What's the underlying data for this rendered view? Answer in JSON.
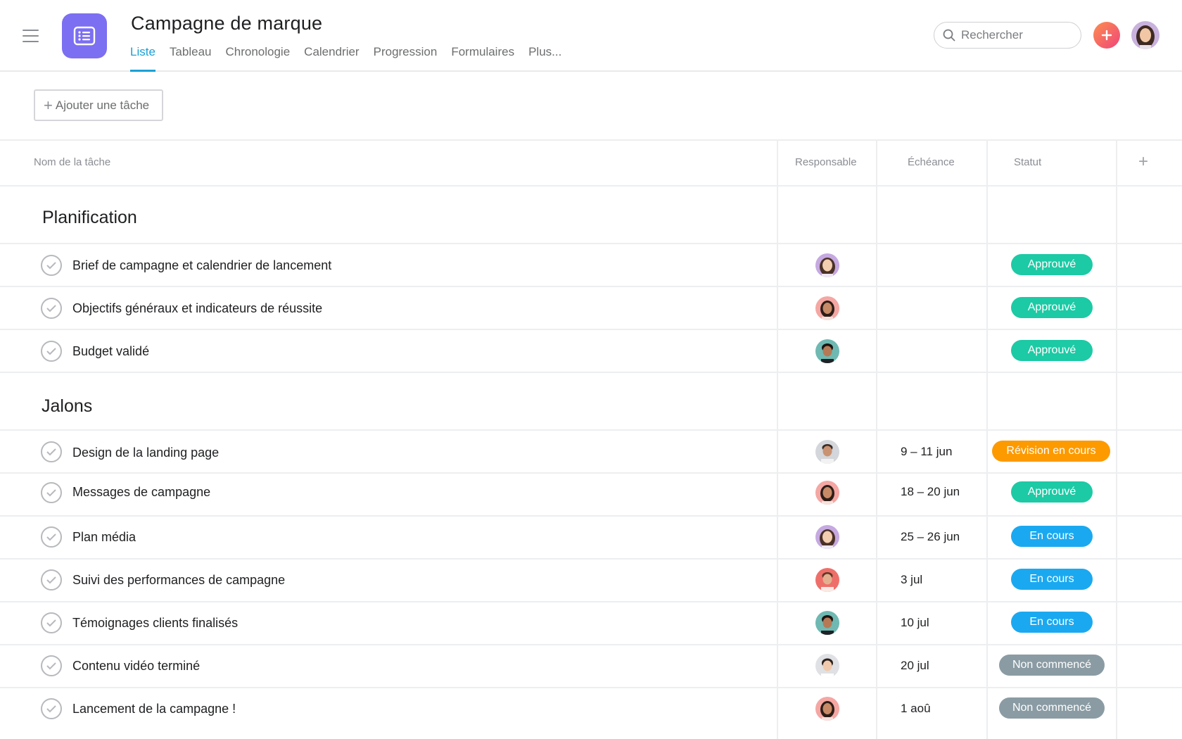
{
  "project": {
    "title": "Campagne de marque",
    "icon": "list-icon",
    "icon_color": "#7c6ff2"
  },
  "tabs": [
    {
      "label": "Liste",
      "active": true
    },
    {
      "label": "Tableau",
      "active": false
    },
    {
      "label": "Chronologie",
      "active": false
    },
    {
      "label": "Calendrier",
      "active": false
    },
    {
      "label": "Progression",
      "active": false
    },
    {
      "label": "Formulaires",
      "active": false
    },
    {
      "label": "Plus...",
      "active": false
    }
  ],
  "search": {
    "placeholder": "Rechercher"
  },
  "toolbar": {
    "add_task_label": "Ajouter une tâche"
  },
  "columns": {
    "name": "Nom de la tâche",
    "assignee": "Responsable",
    "due": "Échéance",
    "status": "Statut",
    "add": "+"
  },
  "status_colors": {
    "Approuvé": "#1ccaa5",
    "Révision en cours": "#fd9a00",
    "En cours": "#1aa9f0",
    "Non commencé": "#8a9ba3"
  },
  "sections": [
    {
      "title": "Planification",
      "tasks": [
        {
          "name": "Brief de campagne et calendrier de lancement",
          "assignee": "avatar-purple-woman",
          "due": "",
          "status": "Approuvé"
        },
        {
          "name": "Objectifs généraux et indicateurs de réussite",
          "assignee": "avatar-pink-woman",
          "due": "",
          "status": "Approuvé"
        },
        {
          "name": "Budget validé",
          "assignee": "avatar-teal-man",
          "due": "",
          "status": "Approuvé"
        }
      ]
    },
    {
      "title": "Jalons",
      "tasks": [
        {
          "name": "Design de la landing page",
          "assignee": "avatar-grey-man",
          "due": "9 – 11 jun",
          "status": "Révision en cours"
        },
        {
          "name": "Messages de campagne",
          "assignee": "avatar-pink-woman",
          "due": "18 – 20 jun",
          "status": "Approuvé"
        },
        {
          "name": "Plan média",
          "assignee": "avatar-purple-woman",
          "due": "25 – 26 jun",
          "status": "En cours"
        },
        {
          "name": "Suivi des performances de campagne",
          "assignee": "avatar-red-man",
          "due": "3 jul",
          "status": "En cours"
        },
        {
          "name": "Témoignages clients finalisés",
          "assignee": "avatar-teal-man",
          "due": "10 jul",
          "status": "En cours"
        },
        {
          "name": "Contenu vidéo terminé",
          "assignee": "avatar-grey-woman",
          "due": "20 jul",
          "status": "Non commencé"
        },
        {
          "name": "Lancement de la campagne !",
          "assignee": "avatar-pink-woman",
          "due": "1 aoû",
          "status": "Non commencé"
        }
      ]
    }
  ]
}
